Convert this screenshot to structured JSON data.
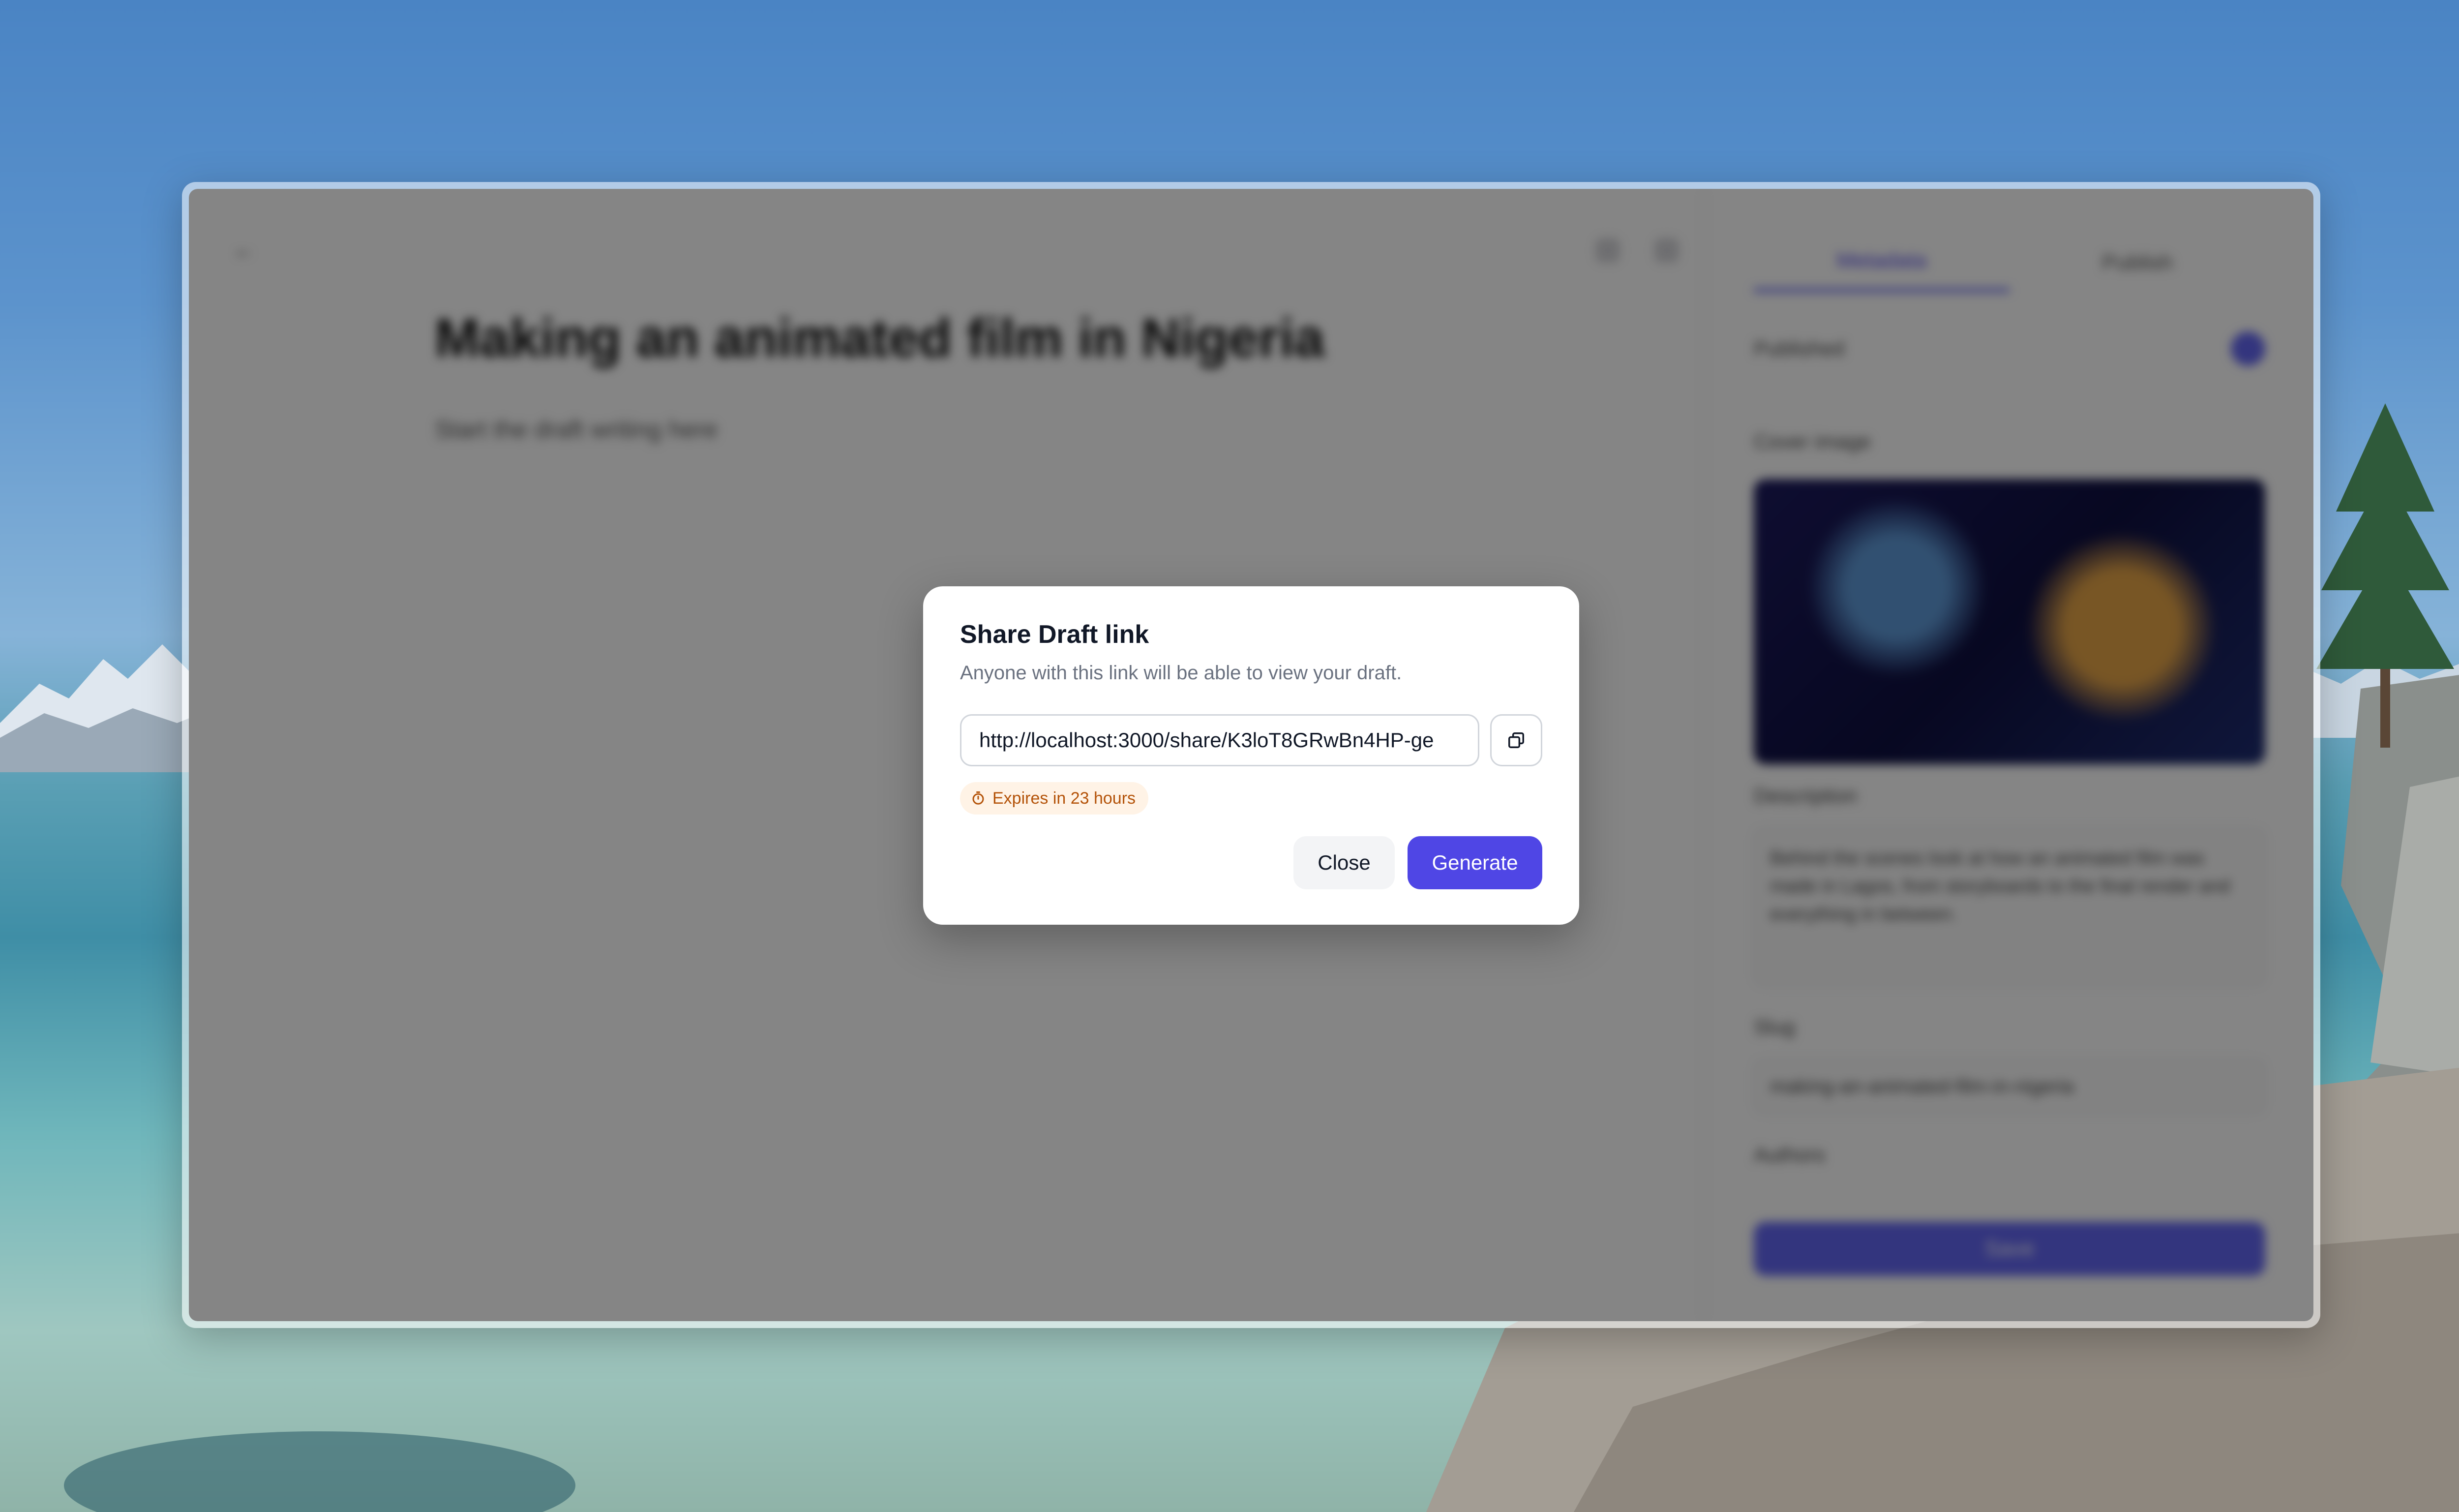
{
  "editor": {
    "back_label": "←",
    "title": "Making an animated film in Nigeria",
    "subtitle": "Start the draft writing here"
  },
  "sidebar": {
    "tabs": [
      {
        "label": "Metadata",
        "active": true
      },
      {
        "label": "Publish",
        "active": false
      }
    ],
    "fields": {
      "published_label": "Published",
      "cover_label": "Cover image",
      "description_label": "Description",
      "description_value": "Behind the scenes look at how an animated film was made in Lagos, from storyboards to the final render and everything in between.",
      "slug_label": "Slug",
      "slug_value": "making-an-animated-film-in-nigeria",
      "authors_label": "Authors",
      "save_label": "Save"
    }
  },
  "modal": {
    "title": "Share Draft link",
    "description": "Anyone with this link will be able to view your draft.",
    "link_value": "http://localhost:3000/share/K3loT8GRwBn4HP-ge",
    "copy_icon": "copy-icon",
    "expiry_icon": "timer-icon",
    "expiry_text": "Expires in 23 hours",
    "close_label": "Close",
    "generate_label": "Generate"
  },
  "colors": {
    "accent": "#4f46e5",
    "expiry_bg": "#fff3e6",
    "expiry_text": "#b45309"
  }
}
